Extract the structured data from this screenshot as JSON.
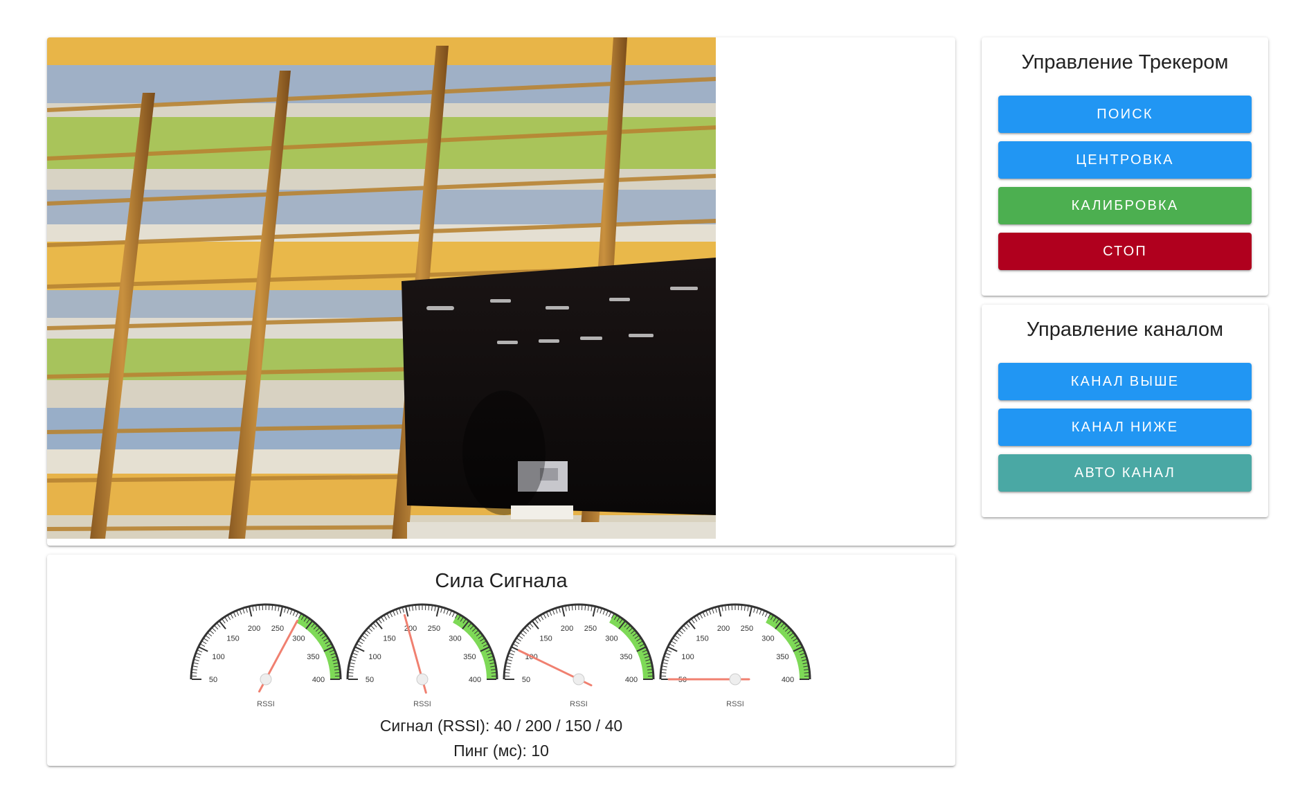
{
  "tracker_panel": {
    "title": "Управление Трекером",
    "buttons": [
      {
        "label": "ПОИСК",
        "color": "#2196f3"
      },
      {
        "label": "ЦЕНТРОВКА",
        "color": "#2196f3"
      },
      {
        "label": "КАЛИБРОВКА",
        "color": "#4caf50"
      },
      {
        "label": "СТОП",
        "color": "#b0001e"
      }
    ]
  },
  "channel_panel": {
    "title": "Управление каналом",
    "buttons": [
      {
        "label": "КАНАЛ ВЫШЕ",
        "color": "#2196f3"
      },
      {
        "label": "КАНАЛ НИЖЕ",
        "color": "#2196f3"
      },
      {
        "label": "АВТО КАНАЛ",
        "color": "#4aa8a4"
      }
    ]
  },
  "signal_panel": {
    "title": "Сила Сигнала",
    "rssi_line": "Сигнал (RSSI): 40 / 200 / 150 / 40",
    "ping_line": "Пинг (мс): 10",
    "gauges": [
      {
        "label": "RSSI",
        "value": 280
      },
      {
        "label": "RSSI",
        "value": 195
      },
      {
        "label": "RSSI",
        "value": 100
      },
      {
        "label": "RSSI",
        "value": 50
      }
    ],
    "gauge_scale": {
      "min": 50,
      "max": 400,
      "ticks": [
        "50",
        "100",
        "150",
        "200",
        "250",
        "300",
        "350",
        "400"
      ],
      "green_from": 280
    },
    "colors": {
      "needle": "#f08070",
      "green_zone": "#7ed957",
      "arc": "#333333"
    }
  }
}
